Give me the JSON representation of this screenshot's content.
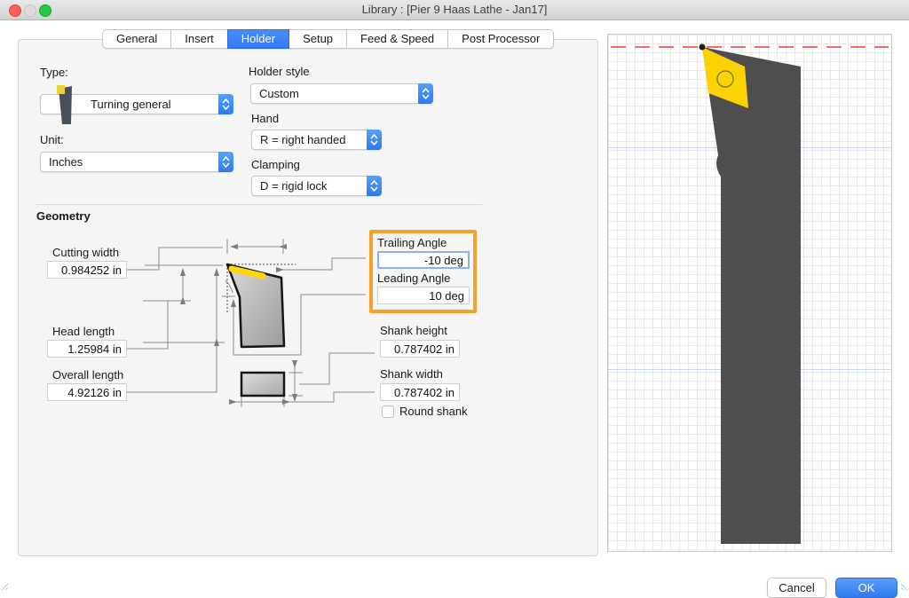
{
  "window": {
    "title": "Library : [Pier 9 Haas Lathe - Jan17]",
    "cancel_label": "Cancel",
    "ok_label": "OK"
  },
  "tabs": {
    "active": "Holder",
    "items": [
      {
        "label": "General"
      },
      {
        "label": "Insert"
      },
      {
        "label": "Holder"
      },
      {
        "label": "Setup"
      },
      {
        "label": "Feed & Speed"
      },
      {
        "label": "Post Processor"
      }
    ]
  },
  "form": {
    "type_label": "Type:",
    "type_value": "Turning general",
    "unit_label": "Unit:",
    "unit_value": "Inches",
    "holder_style_label": "Holder style",
    "holder_style_value": "Custom",
    "hand_label": "Hand",
    "hand_value": "R = right handed",
    "clamping_label": "Clamping",
    "clamping_value": "D = rigid lock"
  },
  "geometry": {
    "section_title": "Geometry",
    "cutting_width": {
      "label": "Cutting width",
      "value": "0.984252 in"
    },
    "head_length": {
      "label": "Head length",
      "value": "1.25984 in"
    },
    "overall_length": {
      "label": "Overall length",
      "value": "4.92126 in"
    },
    "trailing_angle": {
      "label": "Trailing Angle",
      "value": "-10 deg"
    },
    "leading_angle": {
      "label": "Leading Angle",
      "value": "10 deg"
    },
    "shank_height": {
      "label": "Shank height",
      "value": "0.787402 in"
    },
    "shank_width": {
      "label": "Shank width",
      "value": "0.787402 in"
    },
    "round_shank_label": "Round shank",
    "round_shank_checked": false
  },
  "icons": {
    "stepper": "up-down-chevrons",
    "tool_thumbnail": "turning-tool-icon",
    "traffic_lights": [
      "close",
      "minimize",
      "zoom"
    ]
  },
  "colors": {
    "accent_blue": "#2f7af2",
    "highlight_orange": "#f5a12b",
    "insert_yellow": "#fbd304",
    "tool_gray": "#4e4e50",
    "focus_blue": "#85b2f9",
    "red_dash": "#f26d6d"
  }
}
